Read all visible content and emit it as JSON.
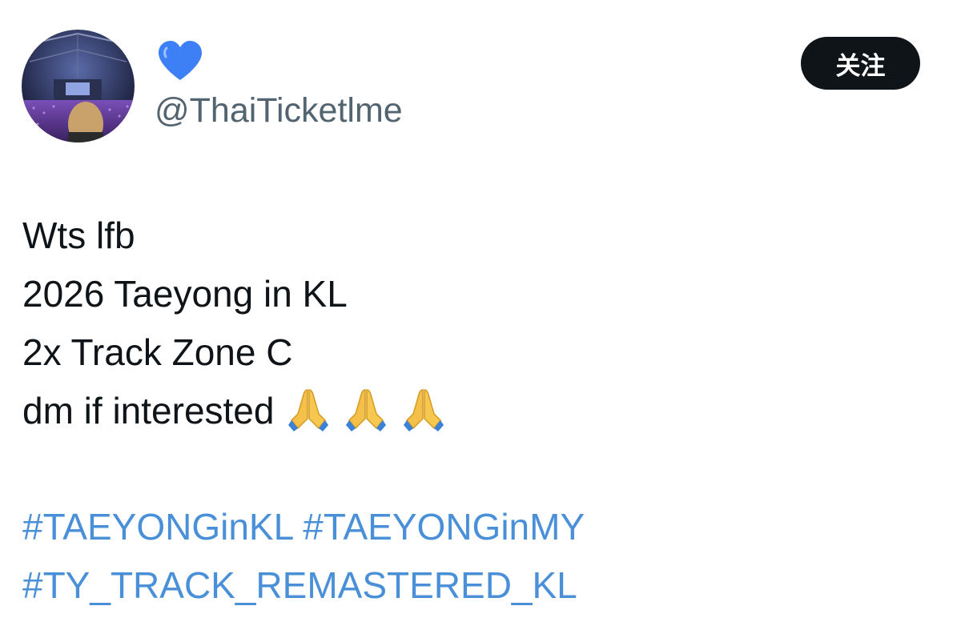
{
  "author": {
    "display_name_icon": "blue-heart-icon",
    "handle": "@ThaiTicketlme",
    "avatar": "concert-crowd-photo"
  },
  "follow_button": {
    "label": "关注",
    "color": "#0f1419",
    "text_color": "#ffffff"
  },
  "tweet": {
    "lines": [
      "Wts lfb",
      "2026 Taeyong in KL",
      "2x Track Zone C",
      "dm if interested"
    ],
    "emoji_icons": [
      "folded-hands-icon",
      "folded-hands-icon",
      "folded-hands-icon"
    ],
    "hashtags": [
      [
        "#TAEYONGinKL",
        "#TAEYONGinMY"
      ],
      [
        "#TY_TRACK_REMASTERED_KL"
      ]
    ]
  },
  "colors": {
    "text": "#0f1419",
    "handle": "#536471",
    "hashtag": "#4a90d9",
    "heart": "#3d7ff5"
  }
}
